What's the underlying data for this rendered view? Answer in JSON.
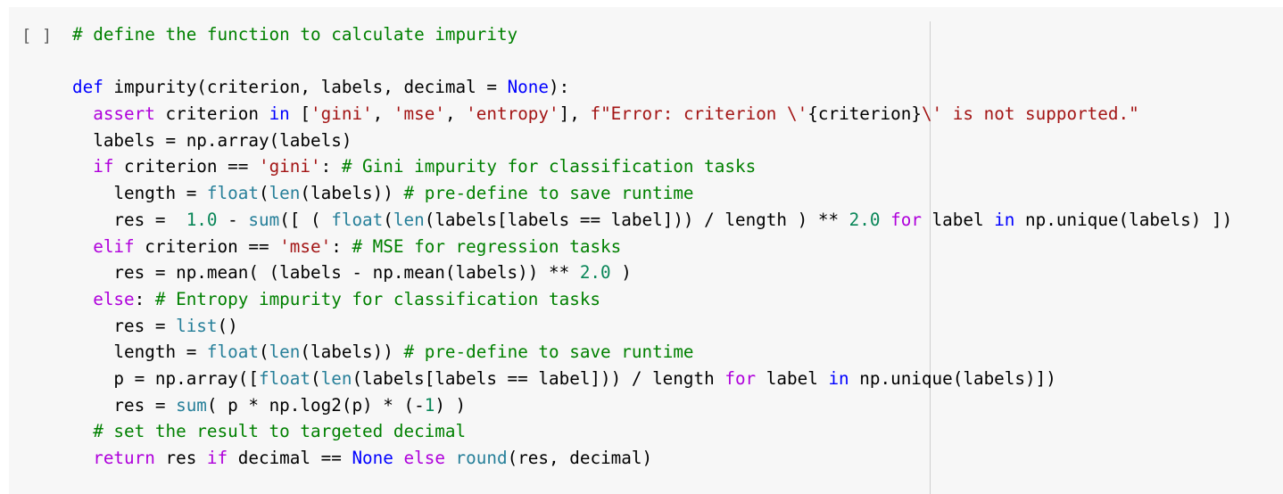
{
  "cell": {
    "run_indicator": "[ ]",
    "lines": [
      [
        {
          "t": "# define the function to calculate impurity",
          "c": "cm"
        }
      ],
      [],
      [
        {
          "t": "def",
          "c": "kw"
        },
        {
          "t": " impurity(criterion, labels, decimal = ",
          "c": "tx"
        },
        {
          "t": "None",
          "c": "kw"
        },
        {
          "t": "):",
          "c": "tx"
        }
      ],
      [
        {
          "t": "  ",
          "c": "tx"
        },
        {
          "t": "assert",
          "c": "kw2"
        },
        {
          "t": " criterion ",
          "c": "tx"
        },
        {
          "t": "in",
          "c": "kw"
        },
        {
          "t": " [",
          "c": "tx"
        },
        {
          "t": "'gini'",
          "c": "st"
        },
        {
          "t": ", ",
          "c": "tx"
        },
        {
          "t": "'mse'",
          "c": "st"
        },
        {
          "t": ", ",
          "c": "tx"
        },
        {
          "t": "'entropy'",
          "c": "st"
        },
        {
          "t": "], ",
          "c": "tx"
        },
        {
          "t": "f\"Error: criterion \\'",
          "c": "st"
        },
        {
          "t": "{criterion}",
          "c": "tx"
        },
        {
          "t": "\\' is not supported.\"",
          "c": "st"
        }
      ],
      [
        {
          "t": "  labels = np.array(labels)",
          "c": "tx"
        }
      ],
      [
        {
          "t": "  ",
          "c": "tx"
        },
        {
          "t": "if",
          "c": "kw2"
        },
        {
          "t": " criterion == ",
          "c": "tx"
        },
        {
          "t": "'gini'",
          "c": "st"
        },
        {
          "t": ": ",
          "c": "tx"
        },
        {
          "t": "# Gini impurity for classification tasks",
          "c": "cm"
        }
      ],
      [
        {
          "t": "    length = ",
          "c": "tx"
        },
        {
          "t": "float",
          "c": "bi"
        },
        {
          "t": "(",
          "c": "tx"
        },
        {
          "t": "len",
          "c": "bi"
        },
        {
          "t": "(labels)) ",
          "c": "tx"
        },
        {
          "t": "# pre-define to save runtime",
          "c": "cm"
        }
      ],
      [
        {
          "t": "    res =  ",
          "c": "tx"
        },
        {
          "t": "1.0",
          "c": "nm"
        },
        {
          "t": " - ",
          "c": "tx"
        },
        {
          "t": "sum",
          "c": "bi"
        },
        {
          "t": "([ ( ",
          "c": "tx"
        },
        {
          "t": "float",
          "c": "bi"
        },
        {
          "t": "(",
          "c": "tx"
        },
        {
          "t": "len",
          "c": "bi"
        },
        {
          "t": "(labels[labels == label])) / length ) ** ",
          "c": "tx"
        },
        {
          "t": "2.0",
          "c": "nm"
        },
        {
          "t": " ",
          "c": "tx"
        },
        {
          "t": "for",
          "c": "kw2"
        },
        {
          "t": " label ",
          "c": "tx"
        },
        {
          "t": "in",
          "c": "kw"
        },
        {
          "t": " np.unique(labels) ])",
          "c": "tx"
        }
      ],
      [
        {
          "t": "  ",
          "c": "tx"
        },
        {
          "t": "elif",
          "c": "kw2"
        },
        {
          "t": " criterion == ",
          "c": "tx"
        },
        {
          "t": "'mse'",
          "c": "st"
        },
        {
          "t": ": ",
          "c": "tx"
        },
        {
          "t": "# MSE for regression tasks",
          "c": "cm"
        }
      ],
      [
        {
          "t": "    res = np.mean( (labels - np.mean(labels)) ** ",
          "c": "tx"
        },
        {
          "t": "2.0",
          "c": "nm"
        },
        {
          "t": " )",
          "c": "tx"
        }
      ],
      [
        {
          "t": "  ",
          "c": "tx"
        },
        {
          "t": "else",
          "c": "kw2"
        },
        {
          "t": ": ",
          "c": "tx"
        },
        {
          "t": "# Entropy impurity for classification tasks",
          "c": "cm"
        }
      ],
      [
        {
          "t": "    res = ",
          "c": "tx"
        },
        {
          "t": "list",
          "c": "bi"
        },
        {
          "t": "()",
          "c": "tx"
        }
      ],
      [
        {
          "t": "    length = ",
          "c": "tx"
        },
        {
          "t": "float",
          "c": "bi"
        },
        {
          "t": "(",
          "c": "tx"
        },
        {
          "t": "len",
          "c": "bi"
        },
        {
          "t": "(labels)) ",
          "c": "tx"
        },
        {
          "t": "# pre-define to save runtime",
          "c": "cm"
        }
      ],
      [
        {
          "t": "    p = np.array([",
          "c": "tx"
        },
        {
          "t": "float",
          "c": "bi"
        },
        {
          "t": "(",
          "c": "tx"
        },
        {
          "t": "len",
          "c": "bi"
        },
        {
          "t": "(labels[labels == label])) / length ",
          "c": "tx"
        },
        {
          "t": "for",
          "c": "kw2"
        },
        {
          "t": " label ",
          "c": "tx"
        },
        {
          "t": "in",
          "c": "kw"
        },
        {
          "t": " np.unique(labels)])",
          "c": "tx"
        }
      ],
      [
        {
          "t": "    res = ",
          "c": "tx"
        },
        {
          "t": "sum",
          "c": "bi"
        },
        {
          "t": "( p * np.log2(p) * (-",
          "c": "tx"
        },
        {
          "t": "1",
          "c": "nm"
        },
        {
          "t": ") )",
          "c": "tx"
        }
      ],
      [
        {
          "t": "  ",
          "c": "tx"
        },
        {
          "t": "# set the result to targeted decimal",
          "c": "cm"
        }
      ],
      [
        {
          "t": "  ",
          "c": "tx"
        },
        {
          "t": "return",
          "c": "kw2"
        },
        {
          "t": " res ",
          "c": "tx"
        },
        {
          "t": "if",
          "c": "kw2"
        },
        {
          "t": " decimal == ",
          "c": "tx"
        },
        {
          "t": "None",
          "c": "kw"
        },
        {
          "t": " ",
          "c": "tx"
        },
        {
          "t": "else",
          "c": "kw2"
        },
        {
          "t": " ",
          "c": "tx"
        },
        {
          "t": "round",
          "c": "bi"
        },
        {
          "t": "(res, decimal)",
          "c": "tx"
        }
      ]
    ]
  }
}
